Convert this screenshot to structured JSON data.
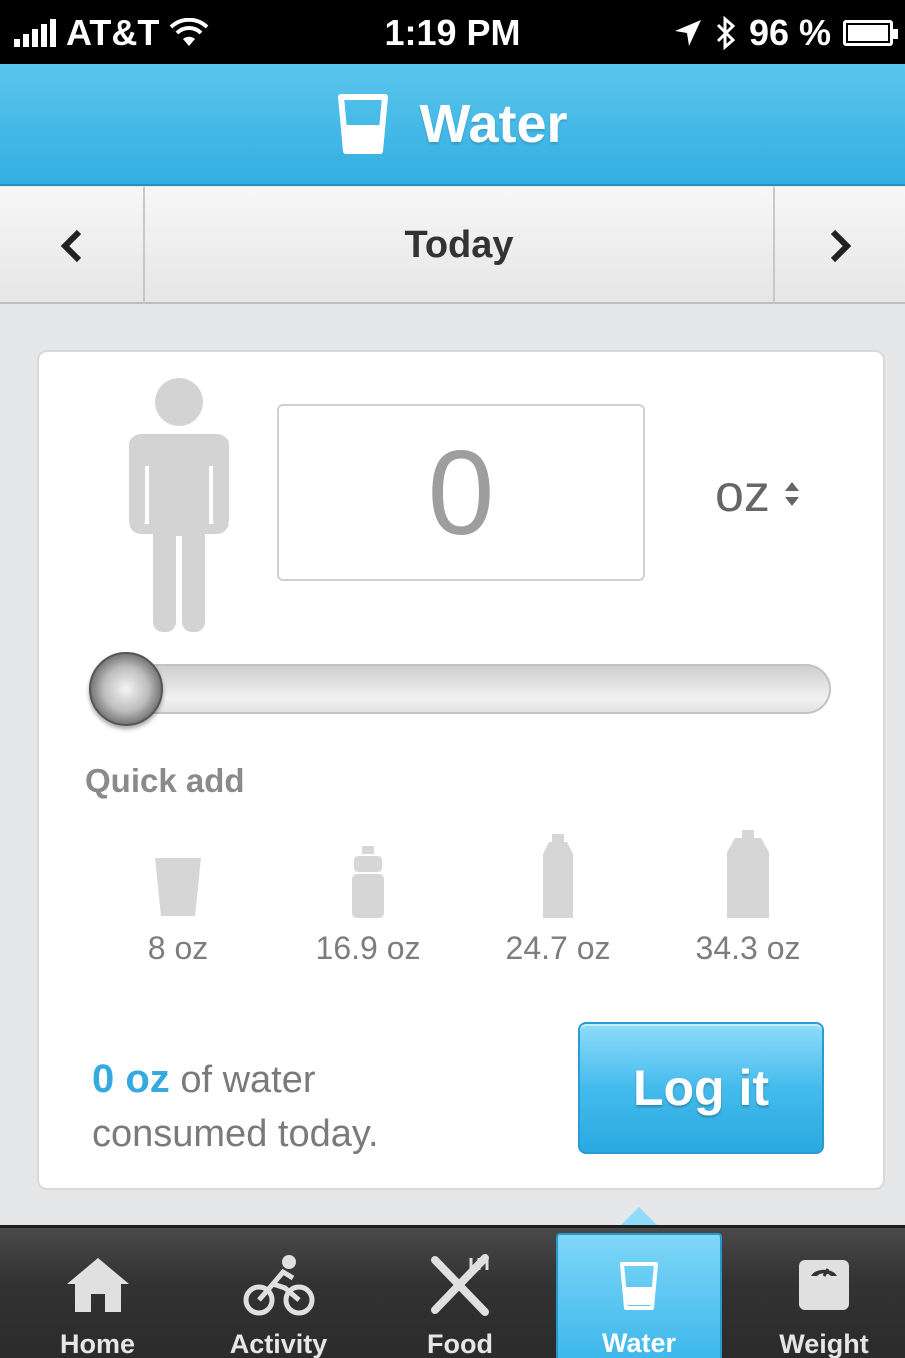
{
  "status_bar": {
    "carrier": "AT&T",
    "time": "1:19 PM",
    "battery": "96 %"
  },
  "header": {
    "title": "Water",
    "icon": "water-glass-icon"
  },
  "date_nav": {
    "label": "Today",
    "prev_icon": "chevron-left-icon",
    "next_icon": "chevron-right-icon"
  },
  "entry": {
    "amount": "0",
    "unit": "oz",
    "slider_level": 0
  },
  "quick_add": {
    "label": "Quick add",
    "items": [
      {
        "label": "8 oz",
        "icon": "cup-icon"
      },
      {
        "label": "16.9 oz",
        "icon": "sport-bottle-icon"
      },
      {
        "label": "24.7 oz",
        "icon": "bottle-icon"
      },
      {
        "label": "34.3 oz",
        "icon": "large-bottle-icon"
      }
    ]
  },
  "summary": {
    "amount": "0 oz",
    "text1": "of water",
    "text2": "consumed today."
  },
  "log_button": "Log it",
  "tabs": [
    {
      "label": "Home",
      "icon": "home-icon"
    },
    {
      "label": "Activity",
      "icon": "cyclist-icon"
    },
    {
      "label": "Food",
      "icon": "fork-knife-icon"
    },
    {
      "label": "Water",
      "icon": "water-glass-icon",
      "active": true
    },
    {
      "label": "Weight",
      "icon": "scale-icon"
    }
  ],
  "colors": {
    "accent": "#36a9e0",
    "header": "#3fb8e6",
    "tabbar": "#333333"
  }
}
